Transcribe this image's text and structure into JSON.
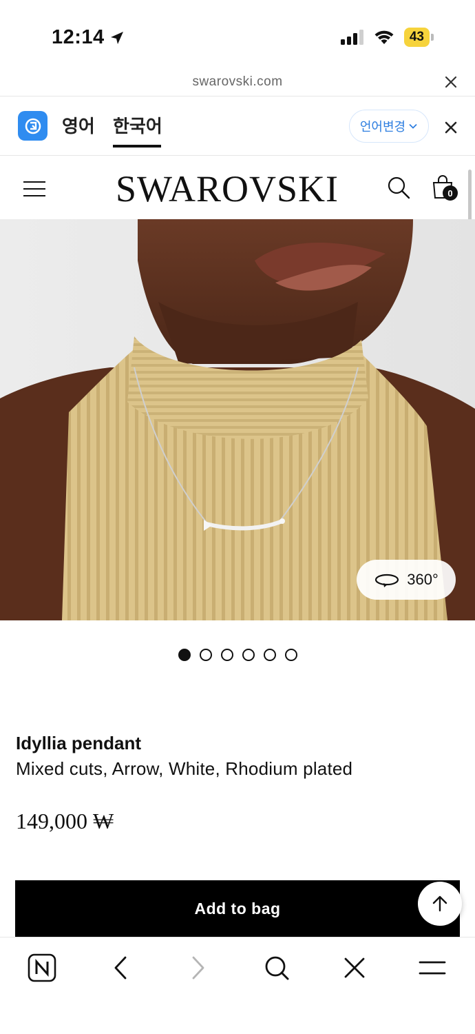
{
  "status_bar": {
    "time": "12:14",
    "battery": "43"
  },
  "url_bar": {
    "domain": "swarovski.com"
  },
  "translate_bar": {
    "tab_source": "영어",
    "tab_target": "한국어",
    "change_language": "언어변경"
  },
  "header": {
    "brand": "SWAROVSKI",
    "bag_count": "0"
  },
  "media": {
    "view_360_label": "360°",
    "slide_count": 6,
    "active_slide": 1
  },
  "product": {
    "name": "Idyllia pendant",
    "description": "Mixed cuts, Arrow, White, Rhodium plated",
    "price": "149,000 ₩"
  },
  "actions": {
    "add_to_bag": "Add to bag"
  },
  "colors": {
    "accent_blue": "#2f7fe0",
    "battery_yellow": "#f6d33c",
    "primary_black": "#000000"
  }
}
